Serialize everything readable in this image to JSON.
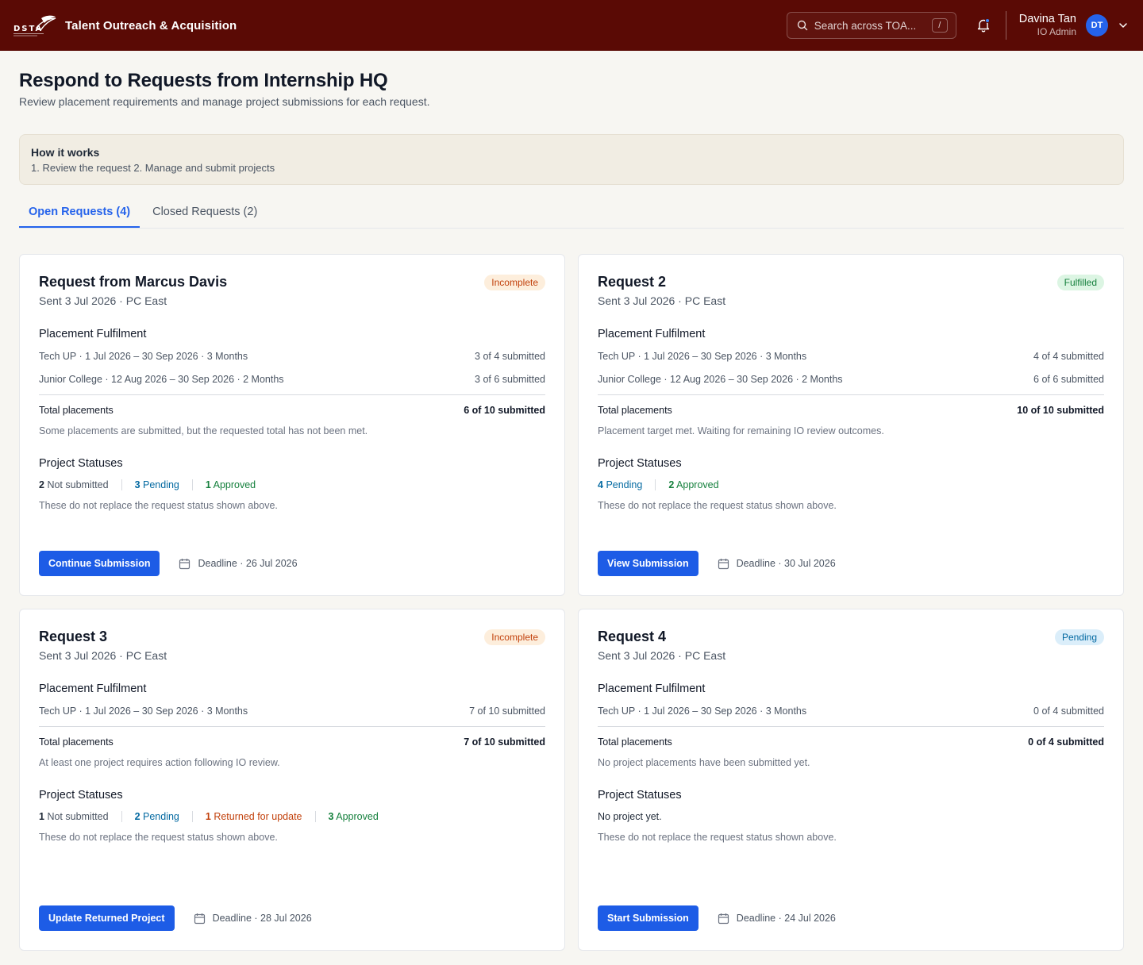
{
  "header": {
    "logo_text": "DSTA",
    "app_title": "Talent Outreach & Acquisition",
    "search_placeholder": "Search across TOA...",
    "search_shortcut": "/",
    "user_name": "Davina Tan",
    "user_role": "IO Admin",
    "user_initials": "DT",
    "brand_color": "#5a0a05"
  },
  "page": {
    "title": "Respond to Requests from Internship HQ",
    "subtitle": "Review placement requirements and manage project submissions for each request."
  },
  "how_it_works": {
    "title": "How it works",
    "steps": "1. Review the request  2. Manage and submit projects"
  },
  "tabs": [
    {
      "label": "Open Requests (4)",
      "active": true
    },
    {
      "label": "Closed Requests (2)",
      "active": false
    }
  ],
  "labels": {
    "placement_fulfilment": "Placement Fulfilment",
    "total_placements": "Total placements",
    "project_statuses": "Project Statuses",
    "status_note": "These do not replace the request status shown above."
  },
  "cards": [
    {
      "title": "Request from Marcus Davis",
      "meta": "Sent 3 Jul 2026 · PC East",
      "badge": "Incomplete",
      "rows": [
        {
          "label": "Tech UP · 1 Jul 2026 – 30 Sep 2026  · 3 Months",
          "value": "3 of 4 submitted"
        },
        {
          "label": "Junior College · 12 Aug 2026 – 30 Sep 2026  · 2 Months",
          "value": "3 of 6 submitted"
        }
      ],
      "total": "6 of 10 submitted",
      "note": "Some placements are submitted, but the requested total has not been met.",
      "statuses": {
        "ns_n": "2",
        "ns_t": "Not submitted",
        "pe_n": "3",
        "pe_t": "Pending",
        "ap_n": "1",
        "ap_t": "Approved"
      },
      "button": "Continue Submission",
      "deadline": "Deadline · 26 Jul 2026"
    },
    {
      "title": "Request 2",
      "meta": "Sent 3 Jul 2026 · PC East",
      "badge": "Fulfilled",
      "rows": [
        {
          "label": "Tech UP · 1 Jul 2026 – 30 Sep 2026  · 3 Months",
          "value": "4 of 4 submitted"
        },
        {
          "label": "Junior College · 12 Aug 2026 – 30 Sep 2026  · 2 Months",
          "value": "6 of 6 submitted"
        }
      ],
      "total": "10 of 10 submitted",
      "note": "Placement target met. Waiting for remaining IO review outcomes.",
      "statuses": {
        "pe_n": "4",
        "pe_t": "Pending",
        "ap_n": "2",
        "ap_t": "Approved"
      },
      "button": "View Submission",
      "deadline": "Deadline · 30 Jul 2026"
    },
    {
      "title": "Request 3",
      "meta": "Sent 3 Jul 2026 · PC East",
      "badge": "Incomplete",
      "rows": [
        {
          "label": "Tech UP · 1 Jul 2026 – 30 Sep 2026  · 3 Months",
          "value": "7 of 10 submitted"
        }
      ],
      "total": "7 of 10 submitted",
      "note": "At least one project requires action following IO review.",
      "statuses": {
        "ns_n": "1",
        "ns_t": "Not submitted",
        "pe_n": "2",
        "pe_t": "Pending",
        "rt_n": "1",
        "rt_t": "Returned for update",
        "ap_n": "3",
        "ap_t": "Approved"
      },
      "button": "Update Returned Project",
      "deadline": "Deadline · 28 Jul 2026"
    },
    {
      "title": "Request 4",
      "meta": "Sent 3 Jul 2026 · PC East",
      "badge": "Pending",
      "rows": [
        {
          "label": "Tech UP · 1 Jul 2026 – 30 Sep 2026  · 3 Months",
          "value": "0 of 4 submitted"
        }
      ],
      "total": "0 of 4 submitted",
      "note": "No project placements have been submitted yet.",
      "statuses": {
        "none": "No project yet."
      },
      "button": "Start Submission",
      "deadline": "Deadline · 24 Jul 2026"
    }
  ]
}
